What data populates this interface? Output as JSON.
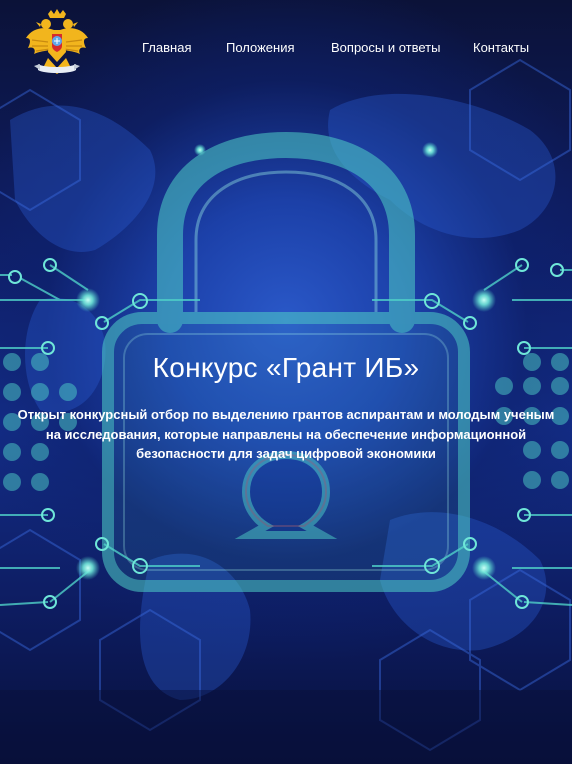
{
  "nav": {
    "items": [
      {
        "label": "Главная"
      },
      {
        "label": "Положения"
      },
      {
        "label": "Вопросы и ответы"
      },
      {
        "label": "Контакты"
      }
    ]
  },
  "logo": {
    "icon": "double-headed-eagle-emblem-icon"
  },
  "hero": {
    "title": "Конкурс «Грант ИБ»",
    "subtitle": "Открыт конкурсный отбор по выделению грантов аспирантам и молодым ученым на исследования, которые направлены на обеспечение информационной безопасности для задач цифровой экономики",
    "background_icon": "padlock-icon"
  },
  "colors": {
    "background_dark": "#0a1240",
    "background_mid": "#1e46b4",
    "accent_teal": "#4fd0c8",
    "emblem_gold": "#f2b51d",
    "emblem_red": "#d62b2b",
    "text": "#ffffff"
  }
}
